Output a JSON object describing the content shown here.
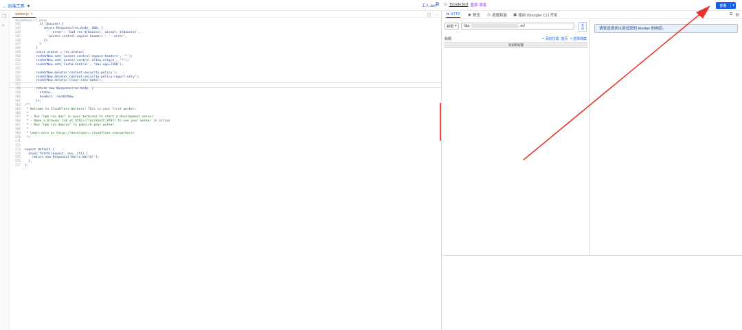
{
  "topbar": {
    "back_label": "← 后端工具",
    "domain_label": "工人.dev",
    "preview_host": "Tocode3ksf",
    "preview_tag": "盖郭·消息",
    "deploy_label": "部署"
  },
  "editor": {
    "tab_label": "worker.js",
    "breadcrumb": "JS worker.js > ⓕ proxy",
    "lines": [
      {
        "n": "142",
        "t": "        if (bauces) {"
      },
      {
        "n": "143",
        "t": "          return Response(res.body, 400, {"
      },
      {
        "n": "144",
        "t": "            '--error': `bad res ${bauces}, accept: ${bauces}`,"
      },
      {
        "n": "145",
        "t": "            'access-control-expose-headers': '--error',"
      },
      {
        "n": "146",
        "t": "          });"
      },
      {
        "n": "147",
        "t": "        }"
      },
      {
        "n": "148",
        "t": "      }"
      },
      {
        "n": "149",
        "t": "      const status = res.status;"
      },
      {
        "n": "150",
        "t": "      resHdrNew.set('access-control-expose-headers', '*');"
      },
      {
        "n": "151",
        "t": "      resHdrNew.set('access-control-allow-origin', '*');"
      },
      {
        "n": "152",
        "t": "      resHdrNew.set('Cache-Control', 'max-age=1500');"
      },
      {
        "n": "153",
        "t": ""
      },
      {
        "n": "154",
        "t": "      resHdrNew.delete('content-security-policy');"
      },
      {
        "n": "155",
        "t": "      resHdrNew.delete('content-security-policy-report-only');"
      },
      {
        "n": "156",
        "t": "      resHdrNew.delete('clear-site-data');"
      },
      {
        "n": "157",
        "t": ""
      },
      {
        "n": "158",
        "t": "      return new Response(res.body, {"
      },
      {
        "n": "159",
        "t": "        status,"
      },
      {
        "n": "160",
        "t": "        headers: resHdrNew,"
      },
      {
        "n": "161",
        "t": "      });"
      },
      {
        "n": "162",
        "t": "/**"
      },
      {
        "n": "163",
        "t": " * Welcome to Cloudflare Workers! This is your first worker."
      },
      {
        "n": "164",
        "t": " *"
      },
      {
        "n": "165",
        "t": " * - Run \"npm run dev\" in your terminal to start a development server"
      },
      {
        "n": "166",
        "t": " * - Open a browser tab at http://localhost:8787/ to see your worker in action"
      },
      {
        "n": "167",
        "t": " * - Run \"npm run deploy\" to publish your worker"
      },
      {
        "n": "168",
        "t": " *"
      },
      {
        "n": "169",
        "t": " * Learn more at https://developers.cloudflare.com/workers/"
      },
      {
        "n": "170",
        "t": " */"
      },
      {
        "n": "171",
        "t": ""
      },
      {
        "n": "172",
        "t": ""
      },
      {
        "n": "173",
        "t": "export default {"
      },
      {
        "n": "174",
        "t": "  async fetch(request, env, ctx) {"
      },
      {
        "n": "175",
        "t": "    return new Response('Hello World!');"
      },
      {
        "n": "176",
        "t": "  },"
      },
      {
        "n": "177",
        "t": "};"
      }
    ]
  },
  "preview": {
    "tabs": [
      {
        "icon": "⇆",
        "label": "HTTP"
      },
      {
        "icon": "◉",
        "label": "预览"
      },
      {
        "icon": "◷",
        "label": "调度刺激"
      },
      {
        "icon": "▣",
        "label": "使用 Wrangler CLI 开发"
      }
    ],
    "method": "获取",
    "url_start": "http",
    "url_end": "ev/",
    "send_label_1": "发",
    "send_label_2": "送",
    "headers_title": "标题",
    "links": [
      "+ 添加位置",
      "首页",
      "+ 选择档案"
    ],
    "add_header": "添加新标题",
    "info_message": "请发送请求以测试您的 Worker 的响应。"
  }
}
